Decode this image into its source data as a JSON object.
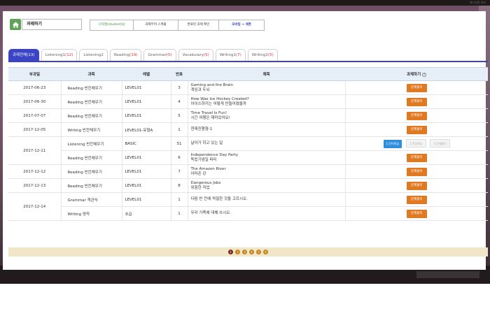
{
  "page": {
    "title": "과제하기",
    "top_right_text": "에너지원 내꺼"
  },
  "nav": {
    "buttons": [
      {
        "label": "나작명(student)님",
        "style": "green"
      },
      {
        "label": "과제무려 스케줄",
        "style": "b2"
      },
      {
        "label": "완료된 과제 확인",
        "style": "b3"
      },
      {
        "label": "모바일 → 개편",
        "style": "accent"
      }
    ]
  },
  "tabs": [
    {
      "label": "과제전체",
      "count": "(13)",
      "active": true
    },
    {
      "label": "Listening1",
      "count": "(12)"
    },
    {
      "label": "Listening2",
      "count": ""
    },
    {
      "label": "Reading",
      "count": "(19)"
    },
    {
      "label": "Grammar",
      "count": "(5)"
    },
    {
      "label": "Vocabulary",
      "count": "(5)"
    },
    {
      "label": "Writing1",
      "count": "(7)"
    },
    {
      "label": "Writing2",
      "count": "(5)"
    }
  ],
  "table": {
    "headers": [
      "부과일",
      "과목",
      "레벨",
      "번호",
      "제목",
      "과제하기"
    ],
    "rows": [
      {
        "date": "2017-06-23",
        "subject": "Reading 빈칸채우기",
        "level": "LEVEL01",
        "num": "3",
        "title": [
          "Gaming and the Brain",
          "게임과 두뇌"
        ],
        "action": "문제풀이"
      },
      {
        "date": "2017-06-30",
        "subject": "Reading 빈칸채우기",
        "level": "LEVEL01",
        "num": "4",
        "title": [
          "How Was Ice Hockey Created?",
          "아이스하키는 어떻게 만들어졌을까"
        ],
        "action": "문제풀이"
      },
      {
        "date": "2017-07-07",
        "subject": "Reading 빈칸채우기",
        "level": "LEVEL01",
        "num": "5",
        "title": [
          "Time Travel Is Fun!",
          "시간 여행은 재미있어요!"
        ],
        "action": "문제풀이"
      },
      {
        "date": "2017-12-05",
        "subject": "Writing 빈칸채우기",
        "level": "LEVEL01-유형A",
        "num": "1",
        "title": [
          "현재진행형-1"
        ],
        "action": "문제풀이"
      },
      {
        "date": "",
        "subject": "Listening 빈칸채우기",
        "level": "BASIC",
        "num": "51",
        "title": [
          "날아가 하고 있는 일"
        ],
        "actions_group": [
          "1.단어학습",
          "2.문장학습",
          "3.문제풀이"
        ]
      },
      {
        "date": "2017-12-11",
        "subject": "Reading 빈칸채우기",
        "level": "LEVEL01",
        "num": "6",
        "title": [
          "Independence Day Party",
          "독립기념일 파티"
        ],
        "action": "문제풀이"
      },
      {
        "date": "2017-12-12",
        "subject": "Reading 빈칸채우기",
        "level": "LEVEL01",
        "num": "7",
        "title": [
          "The Amazon River",
          "아마존 강"
        ],
        "action": "문제풀이"
      },
      {
        "date": "2017-12-13",
        "subject": "Reading 빈칸채우기",
        "level": "LEVEL01",
        "num": "8",
        "title": [
          "Dangerous Jobs",
          "위험한 직업"
        ],
        "action": "문제풀이"
      },
      {
        "date": "",
        "subject": "Grammar 객관식",
        "level": "LEVEL01",
        "num": "1",
        "title": [
          "다음 빈 칸에 적절한 것을 고르시오."
        ],
        "action": "문제풀이"
      },
      {
        "date": "2017-12-14",
        "subject": "Writing 영작",
        "level": "초급",
        "num": "1",
        "title": [
          "우리 가족에 대해 쓰시오."
        ],
        "action": "문제풀이"
      }
    ]
  },
  "pager": {
    "pages": [
      "1",
      "2",
      "3",
      "4",
      "5",
      "6"
    ],
    "current": "1"
  }
}
